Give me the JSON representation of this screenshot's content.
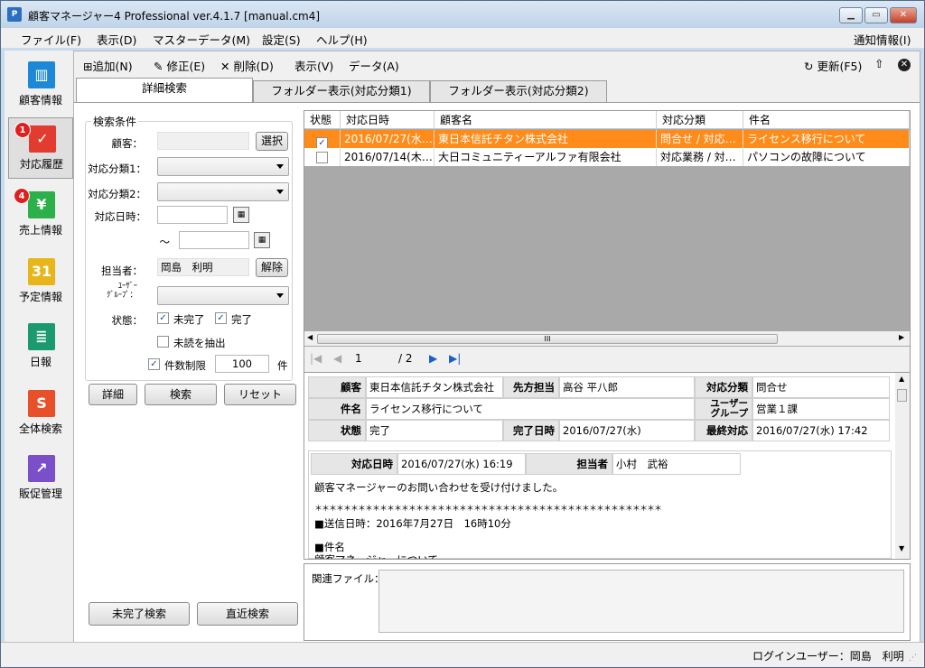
{
  "window": {
    "title": "顧客マネージャー4 Professional ver.4.1.7 [manual.cm4]",
    "icon": "P"
  },
  "menu": {
    "items": [
      "ファイル(F)",
      "表示(D)",
      "マスターデータ(M)",
      "設定(S)",
      "ヘルプ(H)"
    ],
    "notice": "通知情報(I)"
  },
  "sidebar": {
    "items": [
      {
        "label": "顧客情報",
        "color": "#1e88d8",
        "icon": "customer-icon",
        "glyph": "▥"
      },
      {
        "label": "対応履歴",
        "color": "#e23b30",
        "icon": "history-icon",
        "glyph": "✓",
        "badge": "1"
      },
      {
        "label": "売上情報",
        "color": "#2bb04a",
        "icon": "sales-icon",
        "glyph": "¥",
        "badge": "4"
      },
      {
        "label": "予定情報",
        "color": "#e8b61a",
        "icon": "calendar-icon",
        "glyph": "31"
      },
      {
        "label": "日報",
        "color": "#1a9a6e",
        "icon": "report-icon",
        "glyph": "≣"
      },
      {
        "label": "全体検索",
        "color": "#e8502a",
        "icon": "search-all-icon",
        "glyph": "S"
      },
      {
        "label": "販促管理",
        "color": "#7b4fc9",
        "icon": "promotion-icon",
        "glyph": "↗"
      }
    ]
  },
  "toolbar": {
    "add": "追加(N)",
    "edit": "修正(E)",
    "delete": "削除(D)",
    "view": "表示(V)",
    "data": "データ(A)",
    "refresh": "更新(F5)"
  },
  "tabs": [
    "詳細検索",
    "フォルダー表示(対応分類1)",
    "フォルダー表示(対応分類2)"
  ],
  "search": {
    "legend": "検索条件",
    "customer_label": "顧客：",
    "select_button": "選択",
    "cat1_label": "対応分類1：",
    "cat2_label": "対応分類2：",
    "date_label": "対応日時：",
    "tilde": "～",
    "staff_label": "担当者：",
    "staff_value": "岡島　利明",
    "clear_button": "解除",
    "group_label1": "ﾕｰｻﾞｰ",
    "group_label2": "ｸﾞﾙｰﾌﾟ：",
    "status_label": "状態：",
    "incomplete": "未完了",
    "complete": "完了",
    "unread": "未読を抽出",
    "limit_label": "件数制限",
    "limit_value": "100",
    "limit_unit": "件",
    "detail_button": "詳細",
    "search_button": "検索",
    "reset_button": "リセット",
    "incomplete_search": "未完了検索",
    "recent_search": "直近検索"
  },
  "grid": {
    "headers": [
      "状態",
      "対応日時",
      "顧客名",
      "対応分類",
      "件名"
    ],
    "rows": [
      {
        "checked": "✓",
        "date": "2016/07/27(水…",
        "customer": "東日本信託チタン株式会社",
        "category": "問合せ / 対応…",
        "subject": "ライセンス移行について"
      },
      {
        "checked": "",
        "date": "2016/07/14(木…",
        "customer": "大日コミュニティーアルファ有限会社",
        "category": "対応業務 / 対…",
        "subject": "パソコンの故障について"
      }
    ],
    "scroll_glyph": "III",
    "page_current": "1",
    "page_total": "/ 2"
  },
  "detail": {
    "customer_h": "顧客",
    "customer": "東日本信託チタン株式会社",
    "contact_h": "先方担当",
    "contact": "高谷 平八郎",
    "cat_h": "対応分類",
    "cat": "問合せ",
    "subject_h": "件名",
    "subject": "ライセンス移行について",
    "group_h1": "ユーザー",
    "group_h2": "グループ",
    "group": "営業１課",
    "status_h": "状態",
    "status": "完了",
    "done_h": "完了日時",
    "done": "2016/07/27(水)",
    "last_h": "最終対応",
    "last": "2016/07/27(水) 17:42",
    "memo": {
      "date_h": "対応日時",
      "date": "2016/07/27(水) 16:19",
      "staff_h": "担当者",
      "staff": "小村　武裕",
      "lines": [
        "顧客マネージャーのお問い合わせを受け付けました。",
        "",
        "＊＊＊＊＊＊＊＊＊＊＊＊＊＊＊＊＊＊＊＊＊＊＊＊＊＊＊＊＊＊＊＊＊＊＊＊＊＊＊＊＊＊＊＊＊＊＊＊",
        "■送信日時：2016年7月27日　16時10分",
        "",
        "■件名",
        "顧客マネージャーについて"
      ]
    }
  },
  "files": {
    "label": "関連ファイル："
  },
  "status": {
    "login": "ログインユーザー：岡島　利明"
  }
}
